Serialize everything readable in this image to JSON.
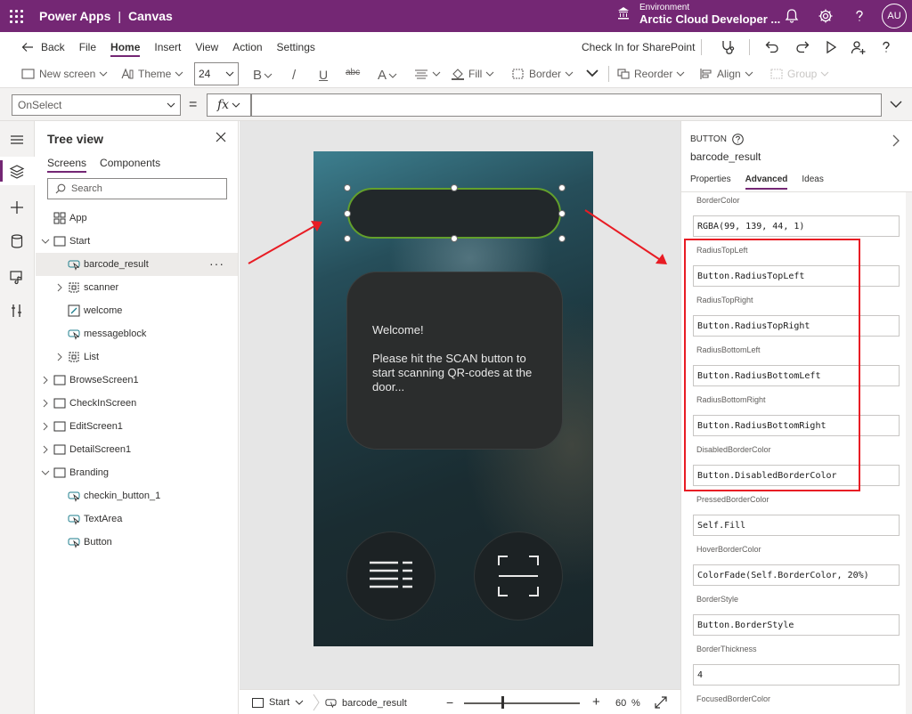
{
  "titlebar": {
    "app_name": "Power Apps",
    "separator": "|",
    "app_type": "Canvas",
    "env_label": "Environment",
    "env_name": "Arctic Cloud Developer ...",
    "avatar": "AU",
    "icons": [
      "waffle-icon",
      "environment-icon",
      "bell-icon",
      "gear-icon",
      "help-icon"
    ]
  },
  "menubar": {
    "back": "Back",
    "items": [
      "File",
      "Home",
      "Insert",
      "View",
      "Action",
      "Settings"
    ],
    "active": "Home",
    "checkin": "Check In for SharePoint"
  },
  "toolbar": {
    "new_screen": "New screen",
    "theme": "Theme",
    "font_size": "24",
    "bold": "B",
    "italic": "/",
    "underline": "U",
    "strike": "abc",
    "font_color": "A",
    "fill": "Fill",
    "border": "Border",
    "reorder": "Reorder",
    "align": "Align",
    "group": "Group"
  },
  "formulabar": {
    "property": "OnSelect",
    "equals": "=",
    "fx": "fx",
    "formula": ""
  },
  "tree": {
    "title": "Tree view",
    "tabs": [
      "Screens",
      "Components"
    ],
    "active_tab": "Screens",
    "search_placeholder": "Search",
    "items": [
      {
        "label": "App",
        "icon": "app-icon",
        "level": 0,
        "chevron": "none"
      },
      {
        "label": "Start",
        "icon": "screen-icon",
        "level": 0,
        "chevron": "down"
      },
      {
        "label": "barcode_result",
        "icon": "button-icon",
        "level": 1,
        "chevron": "none",
        "selected": true
      },
      {
        "label": "scanner",
        "icon": "group-icon",
        "level": 1,
        "chevron": "right"
      },
      {
        "label": "welcome",
        "icon": "label-icon",
        "level": 1,
        "chevron": "none"
      },
      {
        "label": "messageblock",
        "icon": "button-icon",
        "level": 1,
        "chevron": "none"
      },
      {
        "label": "List",
        "icon": "group-icon",
        "level": 1,
        "chevron": "right"
      },
      {
        "label": "BrowseScreen1",
        "icon": "screen-icon",
        "level": 0,
        "chevron": "right"
      },
      {
        "label": "CheckInScreen",
        "icon": "screen-icon",
        "level": 0,
        "chevron": "right"
      },
      {
        "label": "EditScreen1",
        "icon": "screen-icon",
        "level": 0,
        "chevron": "right"
      },
      {
        "label": "DetailScreen1",
        "icon": "screen-icon",
        "level": 0,
        "chevron": "right"
      },
      {
        "label": "Branding",
        "icon": "screen-icon",
        "level": 0,
        "chevron": "down"
      },
      {
        "label": "checkin_button_1",
        "icon": "button-icon",
        "level": 1,
        "chevron": "none"
      },
      {
        "label": "TextArea",
        "icon": "button-icon",
        "level": 1,
        "chevron": "none"
      },
      {
        "label": "Button",
        "icon": "button-icon",
        "level": 1,
        "chevron": "none"
      }
    ],
    "more": "···"
  },
  "canvas": {
    "message": "Welcome!\n\nPlease hit the SCAN button to start scanning QR-codes at the door...",
    "selected_border_color": "#63a02c",
    "footer": {
      "screen": "Start",
      "control": "barcode_result",
      "zoom": "60",
      "zoom_unit": "%",
      "minus": "−",
      "plus": "+"
    }
  },
  "properties": {
    "type": "BUTTON",
    "name": "barcode_result",
    "tabs": [
      "Properties",
      "Advanced",
      "Ideas"
    ],
    "active_tab": "Advanced",
    "rows": [
      {
        "label": "BorderColor",
        "value": "RGBA(99, 139, 44, 1)"
      },
      {
        "label": "RadiusTopLeft",
        "value": "Button.RadiusTopLeft"
      },
      {
        "label": "RadiusTopRight",
        "value": "Button.RadiusTopRight"
      },
      {
        "label": "RadiusBottomLeft",
        "value": "Button.RadiusBottomLeft"
      },
      {
        "label": "RadiusBottomRight",
        "value": "Button.RadiusBottomRight"
      },
      {
        "label": "DisabledBorderColor",
        "value": "Button.DisabledBorderColor"
      },
      {
        "label": "PressedBorderColor",
        "value": "Self.Fill"
      },
      {
        "label": "HoverBorderColor",
        "value": "ColorFade(Self.BorderColor, 20%)"
      },
      {
        "label": "BorderStyle",
        "value": "Button.BorderStyle"
      },
      {
        "label": "BorderThickness",
        "value": "4"
      },
      {
        "label": "FocusedBorderColor",
        "value": ""
      }
    ]
  },
  "colors": {
    "brand": "#742774",
    "annotation": "#e81c24"
  }
}
